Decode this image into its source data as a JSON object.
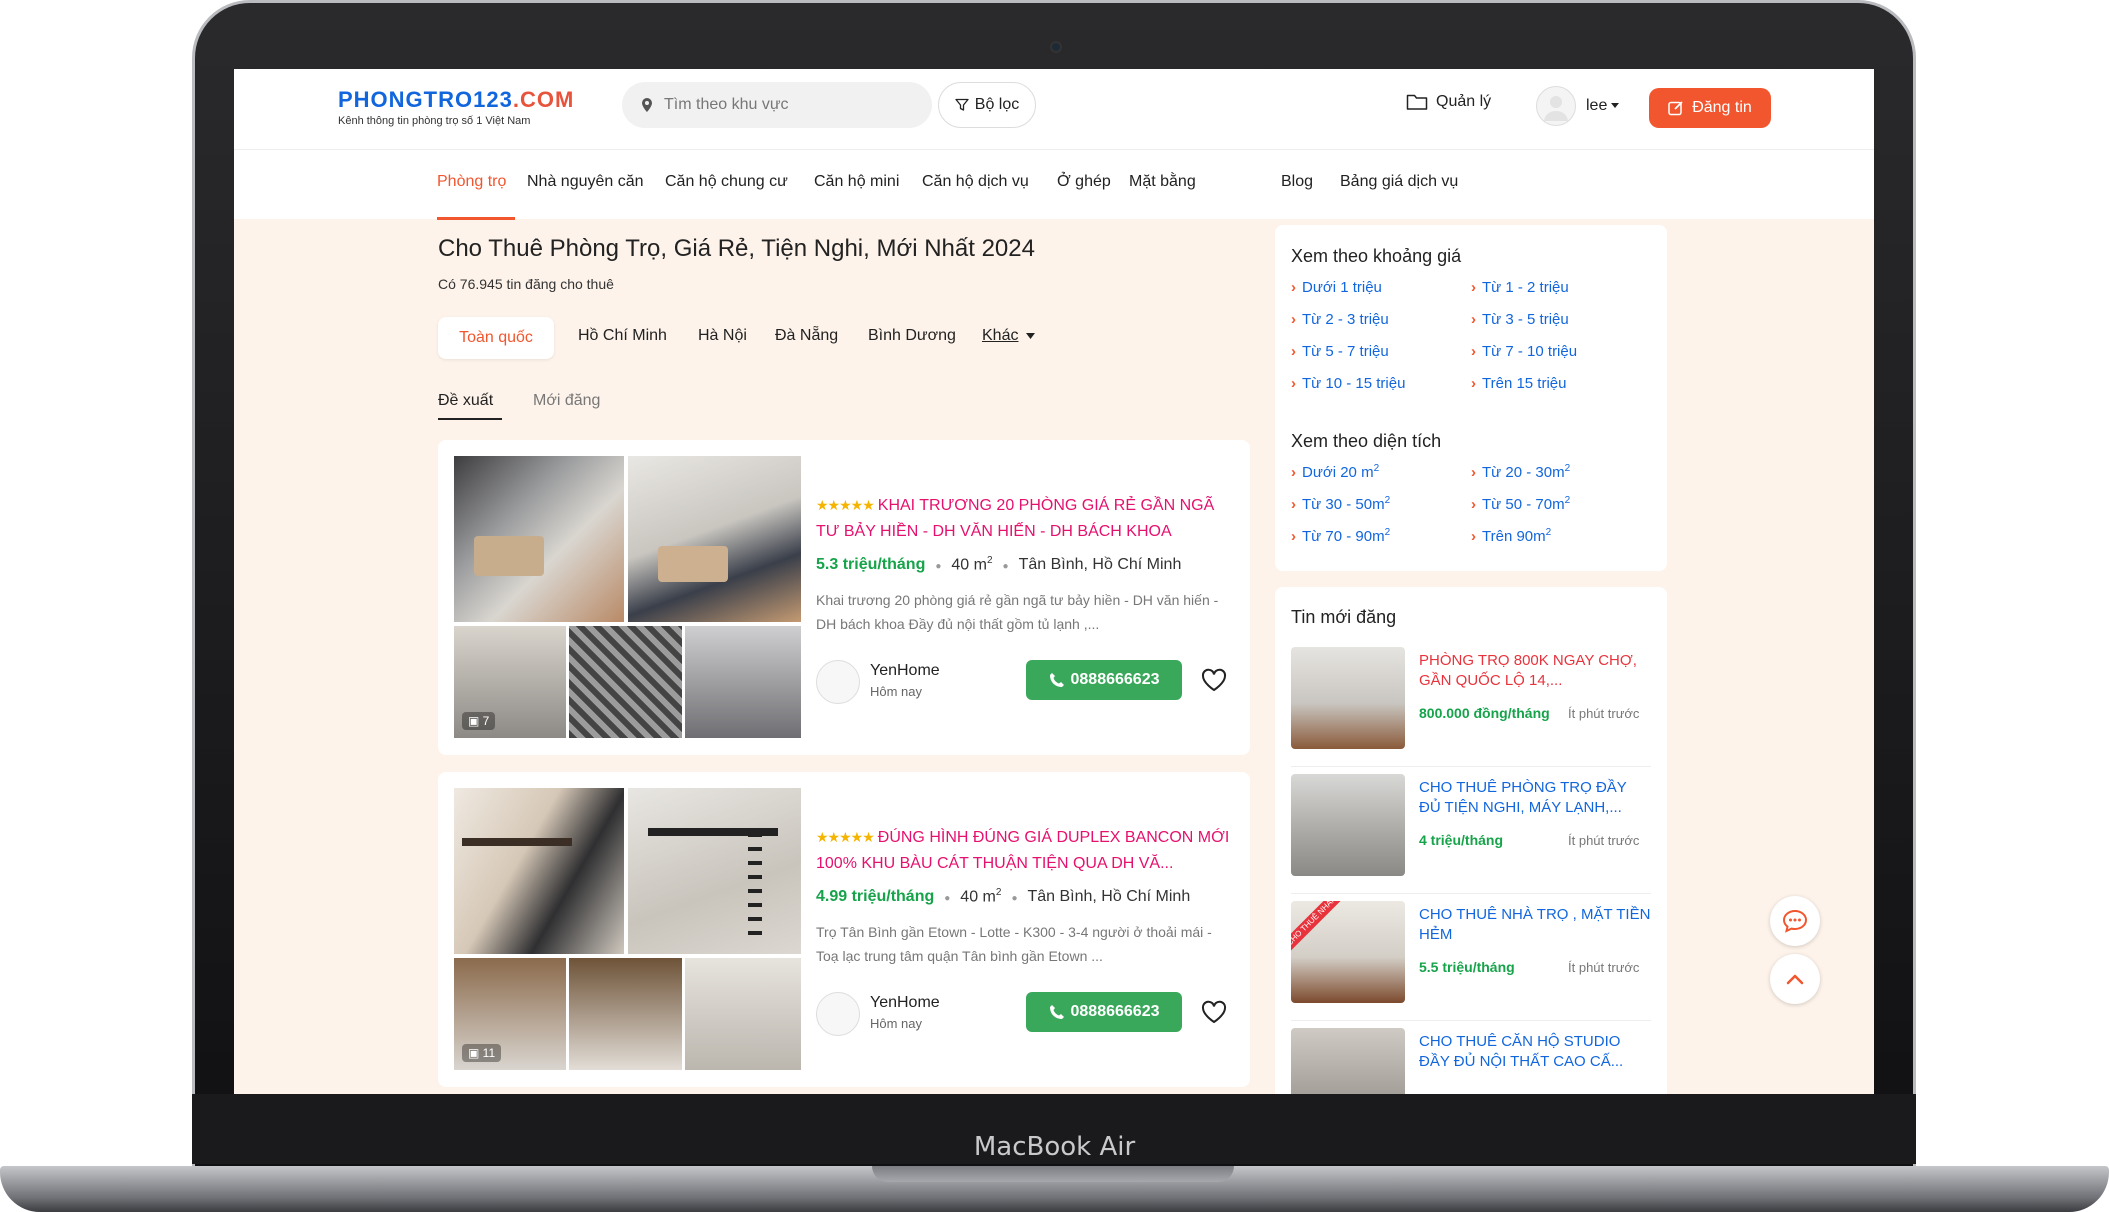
{
  "device": {
    "label": "MacBook Air"
  },
  "header": {
    "logo_main": "PHONGTRO123",
    "logo_tld": ".COM",
    "logo_tagline": "Kênh thông tin phòng trọ số 1 Việt Nam",
    "search_placeholder": "Tìm theo khu vực",
    "filter_label": "Bộ lọc",
    "manage_label": "Quản lý",
    "user_name": "lee",
    "post_label": "Đăng tin"
  },
  "nav": {
    "items": [
      "Phòng trọ",
      "Nhà nguyên căn",
      "Căn hộ chung cư",
      "Căn hộ mini",
      "Căn hộ dịch vụ",
      "Ở ghép",
      "Mặt bằng",
      "Blog",
      "Bảng giá dịch vụ"
    ],
    "active": "Phòng trọ"
  },
  "main": {
    "title": "Cho Thuê Phòng Trọ, Giá Rẻ, Tiện Nghi, Mới Nhất 2024",
    "count": "Có 76.945 tin đăng cho thuê",
    "regions": [
      "Toàn quốc",
      "Hồ Chí Minh",
      "Hà Nội",
      "Đà Nẵng",
      "Bình Dương",
      "Khác"
    ],
    "tabs": [
      "Đề xuất",
      "Mới đăng"
    ],
    "listings": [
      {
        "title": "KHAI TRƯƠNG 20 PHÒNG GIÁ RẺ GẦN NGÃ TƯ BẢY HIỀN - DH VĂN HIẾN - DH BÁCH KHOA",
        "price": "5.3 triệu/tháng",
        "area": "40 m",
        "area_sup": "2",
        "location": "Tân Bình, Hồ Chí Minh",
        "description": "Khai trương 20 phòng giá rẻ gần ngã tư bảy hiền - DH văn hiến - DH bách khoa Đầy đủ nội thất gồm tủ lạnh ,...",
        "photo_count": "7",
        "poster": "YenHome",
        "posted": "Hôm nay",
        "phone": "0888666623"
      },
      {
        "title": "ĐÚNG HÌNH ĐÚNG GIÁ DUPLEX BANCON MỚI 100% KHU BÀU CÁT THUẬN TIỆN QUA DH VĂ...",
        "price": "4.99 triệu/tháng",
        "area": "40 m",
        "area_sup": "2",
        "location": "Tân Bình, Hồ Chí Minh",
        "description": "Trọ Tân Bình gần Etown - Lotte - K300 - 3-4 người ở thoải mái - Toạ lạc trung tâm quận Tân bình gần Etown ...",
        "photo_count": "11",
        "poster": "YenHome",
        "posted": "Hôm nay",
        "phone": "0888666623"
      }
    ]
  },
  "sidebar": {
    "price_title": "Xem theo khoảng giá",
    "price_links": [
      "Dưới 1 triệu",
      "Từ 1 - 2 triệu",
      "Từ 2 - 3 triệu",
      "Từ 3 - 5 triệu",
      "Từ 5 - 7 triệu",
      "Từ 7 - 10 triệu",
      "Từ 10 - 15 triệu",
      "Trên 15 triệu"
    ],
    "area_title": "Xem theo diện tích",
    "area_links": [
      "Dưới 20 m",
      "Từ 20 - 30m",
      "Từ 30 - 50m",
      "Từ 50 - 70m",
      "Từ 70 - 90m",
      "Trên 90m"
    ],
    "area_sup": "2",
    "news_title": "Tin mới đăng",
    "news": [
      {
        "title": "PHÒNG TRỌ 800K NGAY CHỢ, GẦN QUỐC LỘ 14,...",
        "price": "800.000 đồng/tháng",
        "time": "Ít phút trước"
      },
      {
        "title": "CHO THUÊ PHÒNG TRỌ ĐẦY ĐỦ TIỆN NGHI, MÁY LẠNH,...",
        "price": "4 triệu/tháng",
        "time": "Ít phút trước"
      },
      {
        "title": "CHO THUÊ NHÀ TRỌ , MẶT TIỀN HẺM",
        "price": "5.5 triệu/tháng",
        "time": "Ít phút trước",
        "ribbon": "CHO THUÊ NHANH"
      },
      {
        "title": "CHO THUÊ CĂN HỘ STUDIO ĐẦY ĐỦ NỘI THẤT CAO CẤ...",
        "price": "",
        "time": ""
      }
    ]
  },
  "colors": {
    "brand_blue": "#1266dd",
    "accent_orange": "#f1562f",
    "title_pink": "#e5116e",
    "price_green": "#16a34a",
    "page_bg": "#fdf3ea"
  }
}
